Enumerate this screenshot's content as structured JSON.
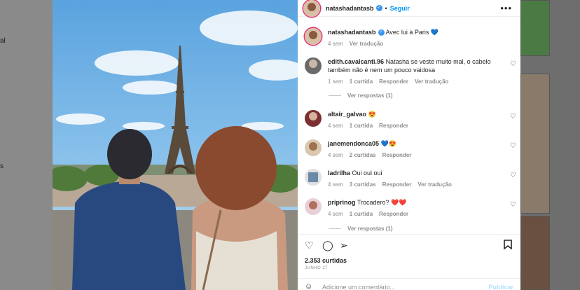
{
  "background": {
    "left_fragments": [
      "al",
      "s"
    ]
  },
  "post": {
    "author": "natashadantasb",
    "follow_label": "Seguir",
    "dot": "•",
    "more_icon": "more-horizontal-icon",
    "caption": {
      "username": "natashadantasb",
      "text": "Avec lui à Paris 💙",
      "time": "4 sem",
      "translate": "Ver tradução"
    },
    "comments": [
      {
        "username": "edith.cavalcanti.96",
        "text": "Natasha se veste muito mal, o cabelo também não é nem um pouco vaidosa",
        "time": "1 sem",
        "likes": "1 curtida",
        "reply": "Responder",
        "translate": "Ver tradução",
        "replies": "Ver respostas (1)"
      },
      {
        "username": "altair_galvao",
        "text": "😍",
        "time": "4 sem",
        "likes": "1 curtida",
        "reply": "Responder"
      },
      {
        "username": "janemendonca05",
        "text": "💙😍",
        "time": "4 sem",
        "likes": "2 curtidas",
        "reply": "Responder"
      },
      {
        "username": "ladrilha",
        "text": "Oui oui oui",
        "time": "4 sem",
        "likes": "3 curtidas",
        "reply": "Responder",
        "translate": "Ver tradução"
      },
      {
        "username": "priprinog",
        "text": "Trocadero? ❤️❤️",
        "time": "4 sem",
        "likes": "1 curtida",
        "reply": "Responder",
        "replies": "Ver respostas (1)"
      }
    ],
    "likes_count": "2.353 curtidas",
    "date": "JUNHO 27",
    "comment_placeholder": "Adicione um comentário...",
    "publish_label": "Publicar",
    "colors": {
      "link": "#0095f6",
      "verified": "#3897f0",
      "meta": "#8e8e8e",
      "text": "#262626"
    }
  }
}
